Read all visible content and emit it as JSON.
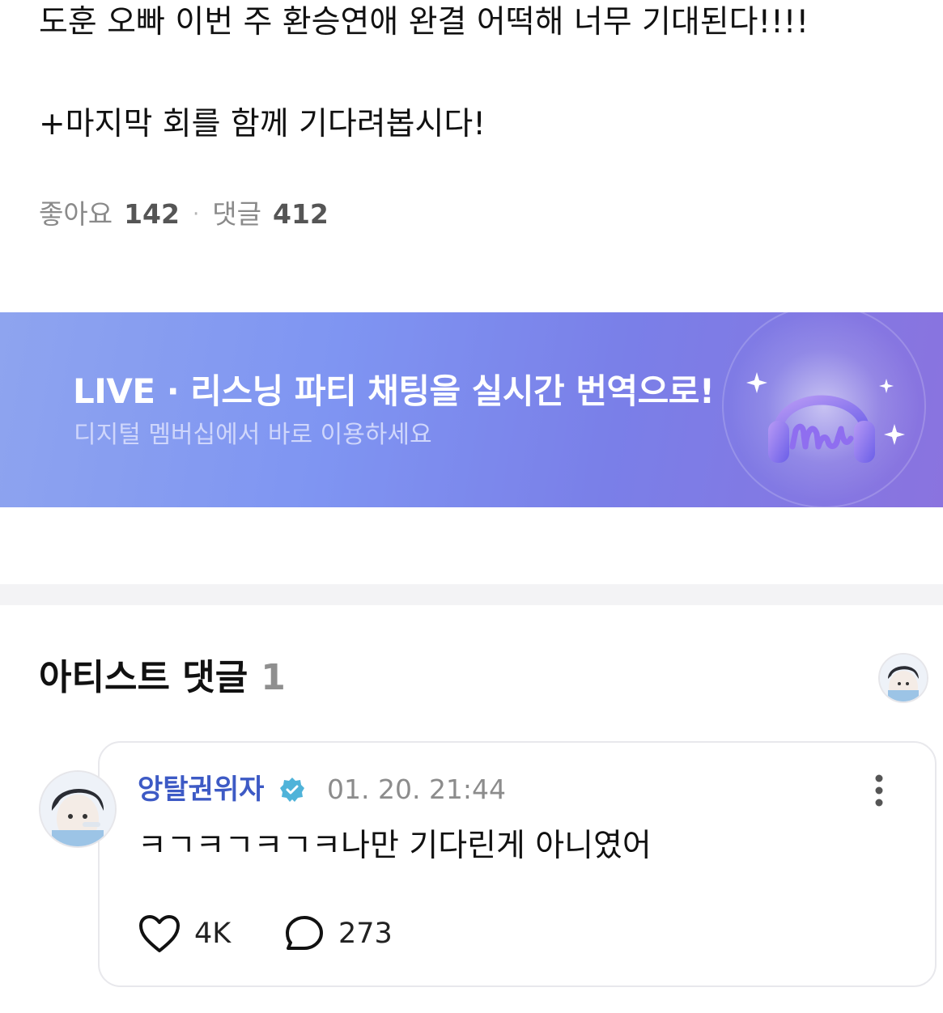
{
  "post": {
    "line1": "도훈 오빠 이번 주 환승연애 완결 어떡해 너무 기대된다!!!!",
    "line2": "+마지막 회를 함께 기다려봅시다!"
  },
  "stats": {
    "likes_label": "좋아요",
    "likes_count": "142",
    "separator": "·",
    "comments_label": "댓글",
    "comments_count": "412"
  },
  "banner": {
    "title": "LIVE · 리스닝 파티 채팅을 실시간 번역으로!",
    "subtitle": "디지털 멤버십에서 바로 이용하세요",
    "logo_icon": "headphones-logo-icon",
    "logo_text": "mu"
  },
  "artist_comments": {
    "title": "아티스트 댓글",
    "count": "1"
  },
  "comment": {
    "author": "앙탈권위자",
    "verified_icon": "verified-badge-icon",
    "time": "01. 20. 21:44",
    "text": "ㅋㄱㅋㄱㅋㄱㅋ나만 기다린게 아니였어",
    "likes": "4K",
    "replies": "273"
  },
  "colors": {
    "author": "#3d5ac5",
    "verified": "#4fb3d9",
    "banner_start": "#8ea4ef",
    "banner_end": "#8a73df"
  }
}
